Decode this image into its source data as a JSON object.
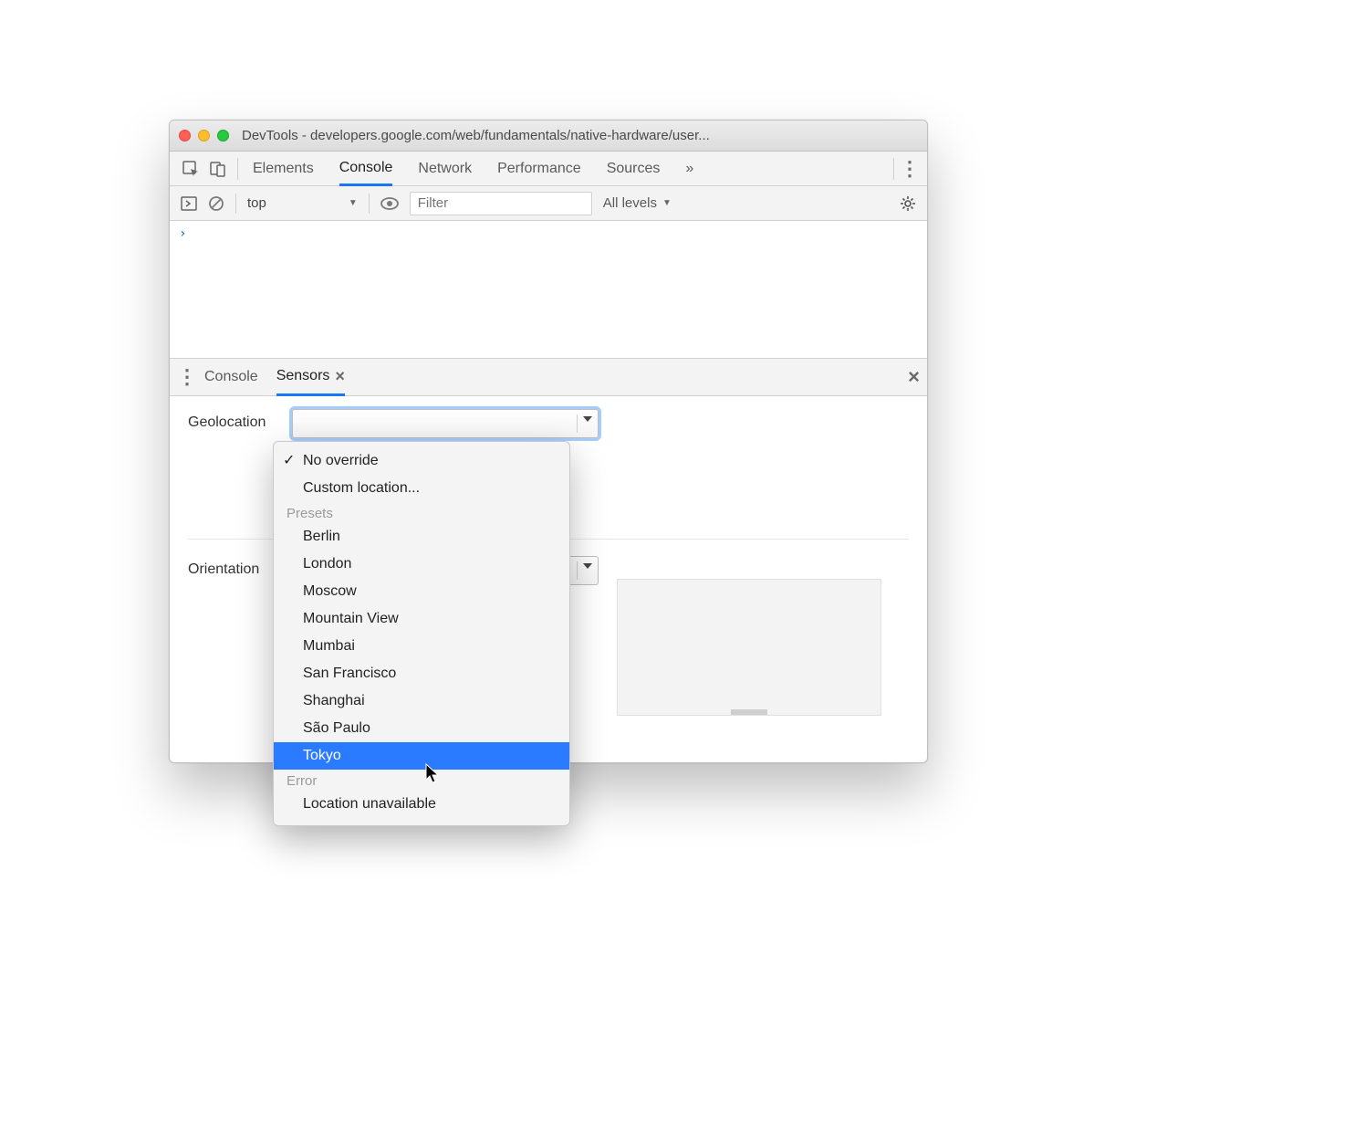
{
  "window": {
    "title": "DevTools - developers.google.com/web/fundamentals/native-hardware/user..."
  },
  "tabs": {
    "items": [
      "Elements",
      "Console",
      "Network",
      "Performance",
      "Sources"
    ],
    "active": "Console",
    "more_glyph": "»"
  },
  "consoleToolbar": {
    "context": "top",
    "filter_placeholder": "Filter",
    "levels": "All levels"
  },
  "console": {
    "prompt": "›"
  },
  "drawer": {
    "tabs": [
      "Console",
      "Sensors"
    ],
    "active": "Sensors"
  },
  "sensors": {
    "geolocation_label": "Geolocation",
    "orientation_label": "Orientation"
  },
  "geolocationDropdown": {
    "no_override": "No override",
    "custom": "Custom location...",
    "presets_header": "Presets",
    "presets": [
      "Berlin",
      "London",
      "Moscow",
      "Mountain View",
      "Mumbai",
      "San Francisco",
      "Shanghai",
      "São Paulo",
      "Tokyo"
    ],
    "error_header": "Error",
    "error_item": "Location unavailable",
    "selected": "No override",
    "highlighted": "Tokyo"
  }
}
